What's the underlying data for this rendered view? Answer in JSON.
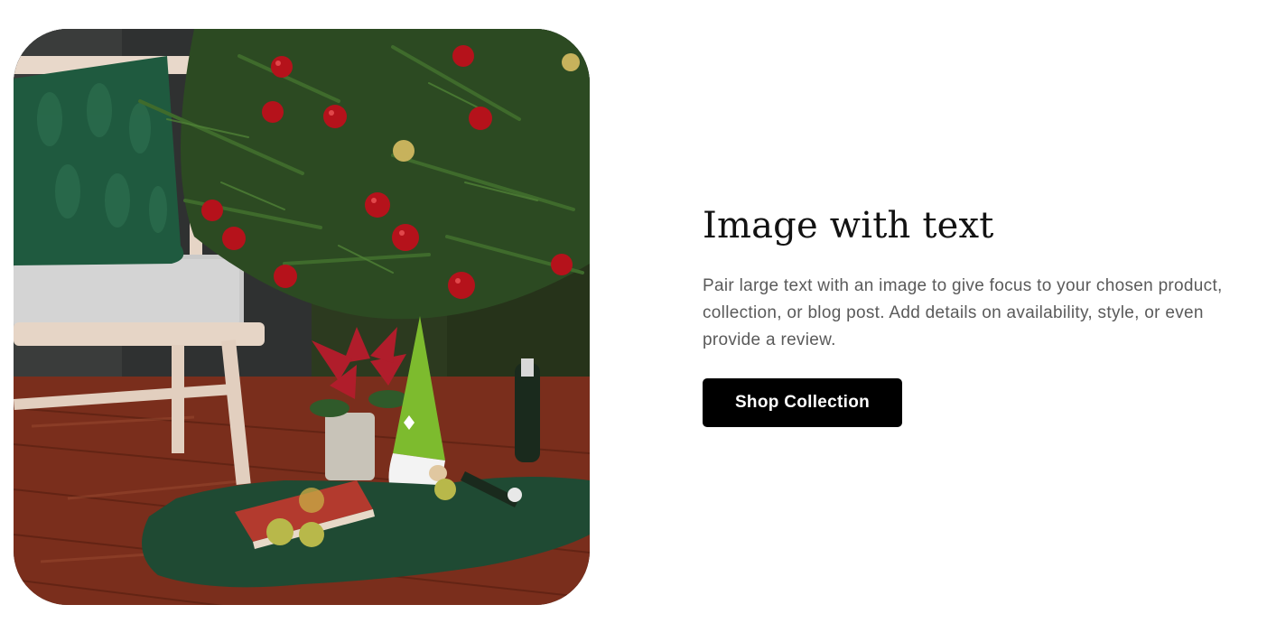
{
  "image_with_text": {
    "heading": "Image with text",
    "text": "Pair large text with an image to give focus to your chosen product, collection, or blog post. Add details on availability, style, or even provide a review.",
    "button_label": "Shop Collection"
  },
  "colors": {
    "button_bg": "#000000",
    "button_text": "#ffffff",
    "heading": "#121212",
    "body_text": "#5a5a5a"
  }
}
